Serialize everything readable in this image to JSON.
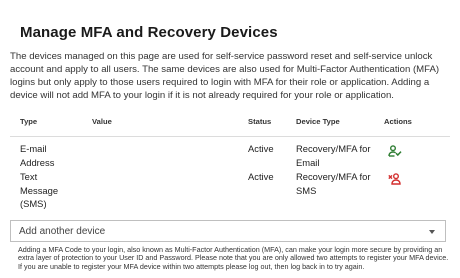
{
  "page": {
    "title": "Manage MFA and Recovery Devices",
    "intro": "The devices managed on this page are used for self-service password reset and self-service unlock account and apply to all users. The same devices are also used for Multi-Factor Authentication (MFA) logins but only apply to those users required to login with MFA for their role or application. Adding a device will not add MFA to your login if it is not already required for your role or application."
  },
  "table": {
    "headers": {
      "type": "Type",
      "value": "Value",
      "status": "Status",
      "device_type": "Device Type",
      "actions": "Actions"
    },
    "rows": [
      {
        "type_line1": "E-mail",
        "type_line2": "Address",
        "value": "",
        "status": "Active",
        "device_type_line1": "Recovery/MFA for",
        "device_type_line2": "Email",
        "action_icon": "person-check-icon",
        "action_color": "#2e7d32"
      },
      {
        "type_line1": "Text",
        "type_line2": "Message",
        "type_line3": "(SMS)",
        "value": "",
        "status": "Active",
        "device_type_line1": "Recovery/MFA for",
        "device_type_line2": "SMS",
        "action_icon": "person-remove-icon",
        "action_color": "#d32f2f"
      }
    ]
  },
  "add_device": {
    "label": "Add another device",
    "icon": "chevron-down-icon"
  },
  "footnote": "Adding a MFA Code to your login, also known as Multi-Factor Authentication (MFA), can make your login more secure by providing an extra layer of protection to your User ID and Password. Please note that you are only allowed two attempts to register your MFA device. If you are unable to register your MFA device within two attempts please log out, then log back in to try again."
}
